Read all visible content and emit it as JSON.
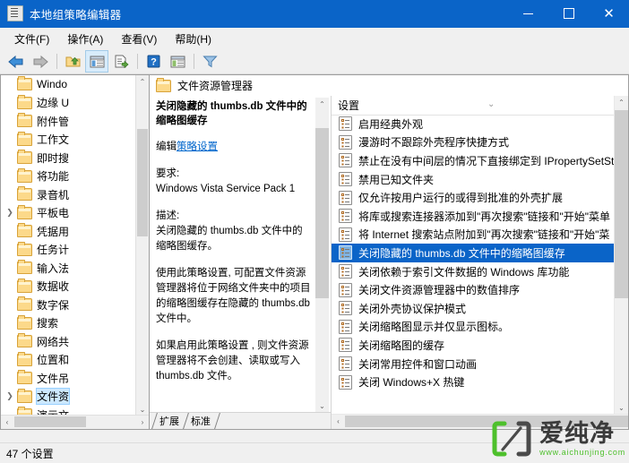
{
  "window": {
    "title": "本地组策略编辑器",
    "icon": "policy-editor-icon",
    "minimize": "−",
    "maximize": "□",
    "close": "✕",
    "accent": "#0a64c8"
  },
  "menubar": {
    "items": [
      {
        "label": "文件(F)",
        "name": "menu-file"
      },
      {
        "label": "操作(A)",
        "name": "menu-action"
      },
      {
        "label": "查看(V)",
        "name": "menu-view"
      },
      {
        "label": "帮助(H)",
        "name": "menu-help"
      }
    ]
  },
  "toolbar": {
    "buttons": [
      {
        "name": "back-icon",
        "glyph": "⬅",
        "color": "#2f7fd0",
        "active": false
      },
      {
        "name": "forward-icon",
        "glyph": "➡",
        "color": "#9a9a9a",
        "active": false
      },
      {
        "name": "up-folder-icon",
        "glyph": "",
        "color": "#d8a33a",
        "active": false
      },
      {
        "name": "show-hide-tree-icon",
        "glyph": "",
        "color": "#4f81bd",
        "active": true
      },
      {
        "name": "export-list-icon",
        "glyph": "",
        "color": "#4f8a3f",
        "active": false
      },
      {
        "name": "help-icon",
        "glyph": "?",
        "color": "#1f6fc4",
        "active": false
      },
      {
        "name": "properties-icon",
        "glyph": "",
        "color": "#4f81bd",
        "active": false
      },
      {
        "name": "filter-icon",
        "glyph": "",
        "color": "#5b9bd5",
        "active": false
      }
    ]
  },
  "tree": {
    "items": [
      {
        "label": "Windo",
        "expandable": false,
        "selected": false
      },
      {
        "label": "边缘 U",
        "expandable": false,
        "selected": false
      },
      {
        "label": "附件管",
        "expandable": false,
        "selected": false
      },
      {
        "label": "工作文",
        "expandable": false,
        "selected": false
      },
      {
        "label": "即时搜",
        "expandable": false,
        "selected": false
      },
      {
        "label": "将功能",
        "expandable": false,
        "selected": false
      },
      {
        "label": "录音机",
        "expandable": false,
        "selected": false
      },
      {
        "label": "平板电",
        "expandable": true,
        "selected": false
      },
      {
        "label": "凭据用",
        "expandable": false,
        "selected": false
      },
      {
        "label": "任务计",
        "expandable": false,
        "selected": false
      },
      {
        "label": "输入法",
        "expandable": false,
        "selected": false
      },
      {
        "label": "数据收",
        "expandable": false,
        "selected": false
      },
      {
        "label": "数字保",
        "expandable": false,
        "selected": false
      },
      {
        "label": "搜索",
        "expandable": false,
        "selected": false
      },
      {
        "label": "网络共",
        "expandable": false,
        "selected": false
      },
      {
        "label": "位置和",
        "expandable": false,
        "selected": false
      },
      {
        "label": "文件吊",
        "expandable": false,
        "selected": false
      },
      {
        "label": "文件资",
        "expandable": true,
        "selected": true
      },
      {
        "label": "演示文",
        "expandable": false,
        "selected": false
      }
    ],
    "scroll_up": "⌃",
    "scroll_down": "⌄",
    "scroll_left": "‹",
    "scroll_right": "›"
  },
  "pane_header": {
    "title": "文件资源管理器",
    "icon": "folder-icon"
  },
  "detail": {
    "title": "关闭隐藏的 thumbs.db 文件中的缩略图缓存",
    "edit_prefix": "编辑",
    "edit_link": "策略设置",
    "requirement_label": "要求:",
    "requirement_value": "Windows Vista Service Pack 1",
    "description_label": "描述:",
    "description_paragraphs": [
      "关闭隐藏的 thumbs.db 文件中的缩略图缓存。",
      "使用此策略设置, 可配置文件资源管理器将位于网络文件夹中的项目的缩略图缓存在隐藏的 thumbs.db 文件中。",
      "如果启用此策略设置 , 则文件资源管理器将不会创建、读取或写入 thumbs.db 文件。"
    ],
    "tabs": [
      {
        "label": "扩展",
        "active": false
      },
      {
        "label": "标准",
        "active": true
      }
    ]
  },
  "list": {
    "column_header": "设置",
    "sort_chevron": "⌄",
    "items": [
      {
        "label": "启用经典外观",
        "selected": false
      },
      {
        "label": "漫游时不跟踪外壳程序快捷方式",
        "selected": false
      },
      {
        "label": "禁止在没有中间层的情况下直接绑定到 IPropertySetSt",
        "selected": false
      },
      {
        "label": "禁用已知文件夹",
        "selected": false
      },
      {
        "label": "仅允许按用户运行的或得到批准的外壳扩展",
        "selected": false
      },
      {
        "label": "将库或搜索连接器添加到\"再次搜索\"链接和\"开始\"菜单",
        "selected": false
      },
      {
        "label": "将 Internet 搜索站点附加到\"再次搜索\"链接和\"开始\"菜",
        "selected": false
      },
      {
        "label": "关闭隐藏的 thumbs.db 文件中的缩略图缓存",
        "selected": true
      },
      {
        "label": "关闭依赖于索引文件数据的 Windows 库功能",
        "selected": false
      },
      {
        "label": "关闭文件资源管理器中的数值排序",
        "selected": false
      },
      {
        "label": "关闭外壳协议保护模式",
        "selected": false
      },
      {
        "label": "关闭缩略图显示并仅显示图标。",
        "selected": false
      },
      {
        "label": "关闭缩略图的缓存",
        "selected": false
      },
      {
        "label": "关闭常用控件和窗口动画",
        "selected": false
      },
      {
        "label": "关闭 Windows+X 热键",
        "selected": false
      }
    ]
  },
  "statusbar": {
    "text": "47 个设置"
  },
  "watermark": {
    "brand": "爱纯净",
    "url": "www.aichunjing.com",
    "color": "#4ec02c"
  }
}
